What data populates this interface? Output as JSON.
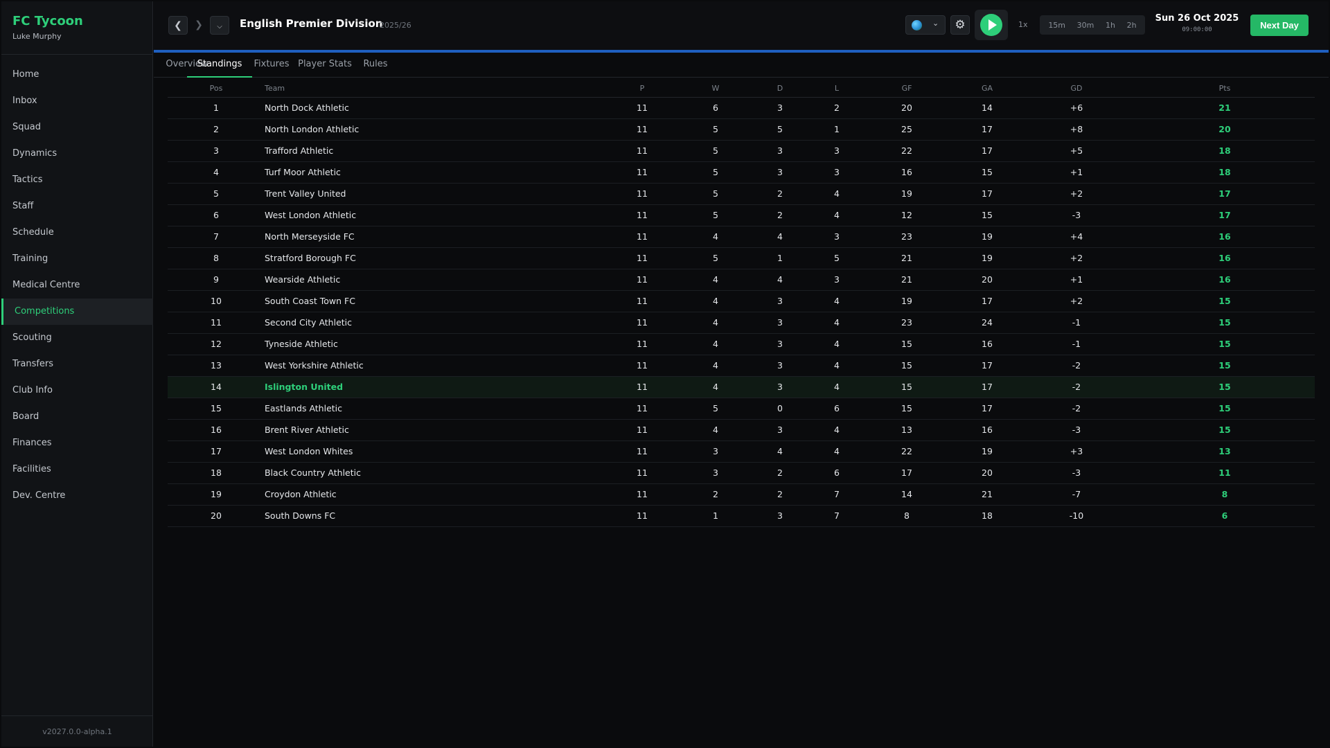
{
  "app": {
    "name": "FC Tycoon",
    "manager": "Luke Murphy",
    "version": "v2027.0.0-alpha.1"
  },
  "sidebar": {
    "items": [
      {
        "label": "Home"
      },
      {
        "label": "Inbox"
      },
      {
        "label": "Squad"
      },
      {
        "label": "Dynamics"
      },
      {
        "label": "Tactics"
      },
      {
        "label": "Staff"
      },
      {
        "label": "Schedule"
      },
      {
        "label": "Training"
      },
      {
        "label": "Medical Centre"
      },
      {
        "label": "Competitions"
      },
      {
        "label": "Scouting"
      },
      {
        "label": "Transfers"
      },
      {
        "label": "Club Info"
      },
      {
        "label": "Board"
      },
      {
        "label": "Finances"
      },
      {
        "label": "Facilities"
      },
      {
        "label": "Dev. Centre"
      }
    ],
    "active": "Competitions"
  },
  "header": {
    "title": "English Premier Division",
    "season": "2025/26",
    "speed": "1x",
    "time_steps": [
      "15m",
      "30m",
      "1h",
      "2h"
    ],
    "date": "Sun 26 Oct 2025",
    "time": "09:00:00",
    "next_day_label": "Next Day"
  },
  "icons": {
    "back": "chevron-left-icon",
    "forward": "chevron-right-icon",
    "history": "chevron-down-icon",
    "globe": "globe-icon",
    "settings": "gear-icon",
    "play": "play-icon"
  },
  "colors": {
    "accent": "#2ecf7a",
    "header_line": "#1f5fbf",
    "next_day": "#25b866"
  },
  "tabs": [
    {
      "label": "Overview"
    },
    {
      "label": "Standings"
    },
    {
      "label": "Fixtures"
    },
    {
      "label": "Player Stats"
    },
    {
      "label": "Rules"
    }
  ],
  "active_tab": "Standings",
  "table": {
    "columns": [
      "Pos",
      "Team",
      "P",
      "W",
      "D",
      "L",
      "GF",
      "GA",
      "GD",
      "Pts"
    ],
    "highlight_team": "Islington United",
    "rows": [
      {
        "pos": "1",
        "team": "North Dock Athletic",
        "p": "11",
        "w": "6",
        "d": "3",
        "l": "2",
        "gf": "20",
        "ga": "14",
        "gd": "+6",
        "pts": "21"
      },
      {
        "pos": "2",
        "team": "North London Athletic",
        "p": "11",
        "w": "5",
        "d": "5",
        "l": "1",
        "gf": "25",
        "ga": "17",
        "gd": "+8",
        "pts": "20"
      },
      {
        "pos": "3",
        "team": "Trafford Athletic",
        "p": "11",
        "w": "5",
        "d": "3",
        "l": "3",
        "gf": "22",
        "ga": "17",
        "gd": "+5",
        "pts": "18"
      },
      {
        "pos": "4",
        "team": "Turf Moor Athletic",
        "p": "11",
        "w": "5",
        "d": "3",
        "l": "3",
        "gf": "16",
        "ga": "15",
        "gd": "+1",
        "pts": "18"
      },
      {
        "pos": "5",
        "team": "Trent Valley United",
        "p": "11",
        "w": "5",
        "d": "2",
        "l": "4",
        "gf": "19",
        "ga": "17",
        "gd": "+2",
        "pts": "17"
      },
      {
        "pos": "6",
        "team": "West London Athletic",
        "p": "11",
        "w": "5",
        "d": "2",
        "l": "4",
        "gf": "12",
        "ga": "15",
        "gd": "-3",
        "pts": "17"
      },
      {
        "pos": "7",
        "team": "North Merseyside FC",
        "p": "11",
        "w": "4",
        "d": "4",
        "l": "3",
        "gf": "23",
        "ga": "19",
        "gd": "+4",
        "pts": "16"
      },
      {
        "pos": "8",
        "team": "Stratford Borough FC",
        "p": "11",
        "w": "5",
        "d": "1",
        "l": "5",
        "gf": "21",
        "ga": "19",
        "gd": "+2",
        "pts": "16"
      },
      {
        "pos": "9",
        "team": "Wearside Athletic",
        "p": "11",
        "w": "4",
        "d": "4",
        "l": "3",
        "gf": "21",
        "ga": "20",
        "gd": "+1",
        "pts": "16"
      },
      {
        "pos": "10",
        "team": "South Coast Town FC",
        "p": "11",
        "w": "4",
        "d": "3",
        "l": "4",
        "gf": "19",
        "ga": "17",
        "gd": "+2",
        "pts": "15"
      },
      {
        "pos": "11",
        "team": "Second City Athletic",
        "p": "11",
        "w": "4",
        "d": "3",
        "l": "4",
        "gf": "23",
        "ga": "24",
        "gd": "-1",
        "pts": "15"
      },
      {
        "pos": "12",
        "team": "Tyneside Athletic",
        "p": "11",
        "w": "4",
        "d": "3",
        "l": "4",
        "gf": "15",
        "ga": "16",
        "gd": "-1",
        "pts": "15"
      },
      {
        "pos": "13",
        "team": "West Yorkshire Athletic",
        "p": "11",
        "w": "4",
        "d": "3",
        "l": "4",
        "gf": "15",
        "ga": "17",
        "gd": "-2",
        "pts": "15"
      },
      {
        "pos": "14",
        "team": "Islington United",
        "p": "11",
        "w": "4",
        "d": "3",
        "l": "4",
        "gf": "15",
        "ga": "17",
        "gd": "-2",
        "pts": "15"
      },
      {
        "pos": "15",
        "team": "Eastlands Athletic",
        "p": "11",
        "w": "5",
        "d": "0",
        "l": "6",
        "gf": "15",
        "ga": "17",
        "gd": "-2",
        "pts": "15"
      },
      {
        "pos": "16",
        "team": "Brent River Athletic",
        "p": "11",
        "w": "4",
        "d": "3",
        "l": "4",
        "gf": "13",
        "ga": "16",
        "gd": "-3",
        "pts": "15"
      },
      {
        "pos": "17",
        "team": "West London Whites",
        "p": "11",
        "w": "3",
        "d": "4",
        "l": "4",
        "gf": "22",
        "ga": "19",
        "gd": "+3",
        "pts": "13"
      },
      {
        "pos": "18",
        "team": "Black Country Athletic",
        "p": "11",
        "w": "3",
        "d": "2",
        "l": "6",
        "gf": "17",
        "ga": "20",
        "gd": "-3",
        "pts": "11"
      },
      {
        "pos": "19",
        "team": "Croydon Athletic",
        "p": "11",
        "w": "2",
        "d": "2",
        "l": "7",
        "gf": "14",
        "ga": "21",
        "gd": "-7",
        "pts": "8"
      },
      {
        "pos": "20",
        "team": "South Downs FC",
        "p": "11",
        "w": "1",
        "d": "3",
        "l": "7",
        "gf": "8",
        "ga": "18",
        "gd": "-10",
        "pts": "6"
      }
    ]
  }
}
